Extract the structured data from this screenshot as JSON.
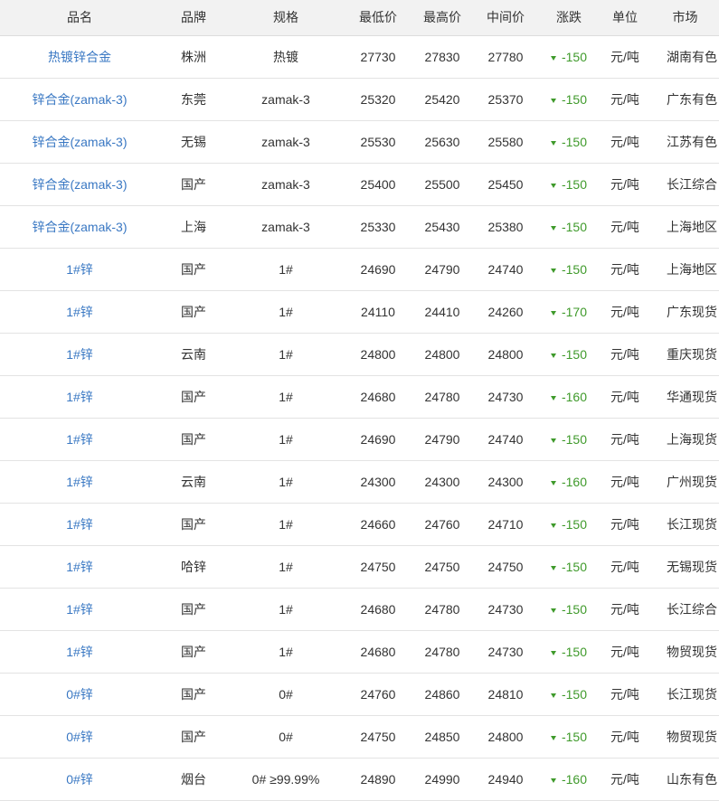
{
  "table": {
    "headers": {
      "name": "品名",
      "brand": "品牌",
      "spec": "规格",
      "low": "最低价",
      "high": "最高价",
      "mid": "中间价",
      "change": "涨跌",
      "unit": "单位",
      "market": "市场"
    },
    "trend_icon": "down-arrow-icon",
    "colors": {
      "link": "#3a78c3",
      "change_down": "#3f9a2b",
      "header_bg": "#f2f2f2"
    },
    "rows": [
      {
        "name": "热镀锌合金",
        "brand": "株洲",
        "spec": "热镀",
        "low": "27730",
        "high": "27830",
        "mid": "27780",
        "change": "-150",
        "unit": "元/吨",
        "market": "湖南有色"
      },
      {
        "name": "锌合金(zamak-3)",
        "brand": "东莞",
        "spec": "zamak-3",
        "low": "25320",
        "high": "25420",
        "mid": "25370",
        "change": "-150",
        "unit": "元/吨",
        "market": "广东有色"
      },
      {
        "name": "锌合金(zamak-3)",
        "brand": "无锡",
        "spec": "zamak-3",
        "low": "25530",
        "high": "25630",
        "mid": "25580",
        "change": "-150",
        "unit": "元/吨",
        "market": "江苏有色"
      },
      {
        "name": "锌合金(zamak-3)",
        "brand": "国产",
        "spec": "zamak-3",
        "low": "25400",
        "high": "25500",
        "mid": "25450",
        "change": "-150",
        "unit": "元/吨",
        "market": "长江综合"
      },
      {
        "name": "锌合金(zamak-3)",
        "brand": "上海",
        "spec": "zamak-3",
        "low": "25330",
        "high": "25430",
        "mid": "25380",
        "change": "-150",
        "unit": "元/吨",
        "market": "上海地区"
      },
      {
        "name": "1#锌",
        "brand": "国产",
        "spec": "1#",
        "low": "24690",
        "high": "24790",
        "mid": "24740",
        "change": "-150",
        "unit": "元/吨",
        "market": "上海地区"
      },
      {
        "name": "1#锌",
        "brand": "国产",
        "spec": "1#",
        "low": "24110",
        "high": "24410",
        "mid": "24260",
        "change": "-170",
        "unit": "元/吨",
        "market": "广东现货"
      },
      {
        "name": "1#锌",
        "brand": "云南",
        "spec": "1#",
        "low": "24800",
        "high": "24800",
        "mid": "24800",
        "change": "-150",
        "unit": "元/吨",
        "market": "重庆现货"
      },
      {
        "name": "1#锌",
        "brand": "国产",
        "spec": "1#",
        "low": "24680",
        "high": "24780",
        "mid": "24730",
        "change": "-160",
        "unit": "元/吨",
        "market": "华通现货"
      },
      {
        "name": "1#锌",
        "brand": "国产",
        "spec": "1#",
        "low": "24690",
        "high": "24790",
        "mid": "24740",
        "change": "-150",
        "unit": "元/吨",
        "market": "上海现货"
      },
      {
        "name": "1#锌",
        "brand": "云南",
        "spec": "1#",
        "low": "24300",
        "high": "24300",
        "mid": "24300",
        "change": "-160",
        "unit": "元/吨",
        "market": "广州现货"
      },
      {
        "name": "1#锌",
        "brand": "国产",
        "spec": "1#",
        "low": "24660",
        "high": "24760",
        "mid": "24710",
        "change": "-150",
        "unit": "元/吨",
        "market": "长江现货"
      },
      {
        "name": "1#锌",
        "brand": "哈锌",
        "spec": "1#",
        "low": "24750",
        "high": "24750",
        "mid": "24750",
        "change": "-150",
        "unit": "元/吨",
        "market": "无锡现货"
      },
      {
        "name": "1#锌",
        "brand": "国产",
        "spec": "1#",
        "low": "24680",
        "high": "24780",
        "mid": "24730",
        "change": "-150",
        "unit": "元/吨",
        "market": "长江综合"
      },
      {
        "name": "1#锌",
        "brand": "国产",
        "spec": "1#",
        "low": "24680",
        "high": "24780",
        "mid": "24730",
        "change": "-150",
        "unit": "元/吨",
        "market": "物贸现货"
      },
      {
        "name": "0#锌",
        "brand": "国产",
        "spec": "0#",
        "low": "24760",
        "high": "24860",
        "mid": "24810",
        "change": "-150",
        "unit": "元/吨",
        "market": "长江现货"
      },
      {
        "name": "0#锌",
        "brand": "国产",
        "spec": "0#",
        "low": "24750",
        "high": "24850",
        "mid": "24800",
        "change": "-150",
        "unit": "元/吨",
        "market": "物贸现货"
      },
      {
        "name": "0#锌",
        "brand": "烟台",
        "spec": "0# ≥99.99%",
        "low": "24890",
        "high": "24990",
        "mid": "24940",
        "change": "-160",
        "unit": "元/吨",
        "market": "山东有色"
      }
    ]
  }
}
